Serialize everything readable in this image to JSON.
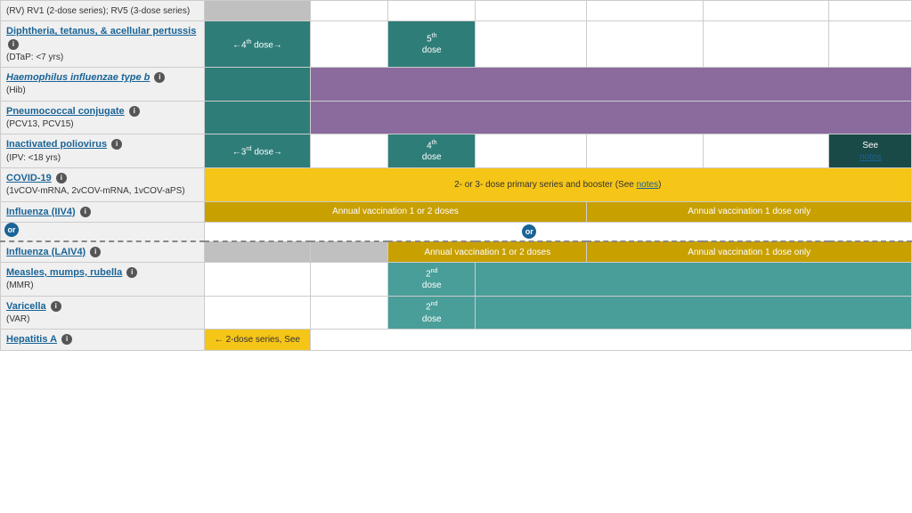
{
  "rows": [
    {
      "id": "rv",
      "label_top": "(RV) RV1 (2-dose series); RV5 (3-dose series)",
      "label_link": null,
      "label_italic": false,
      "label_sub": null,
      "show_info": false,
      "cells": [
        {
          "colspan": 1,
          "bg": "gray-cell",
          "text": ""
        },
        {
          "colspan": 1,
          "bg": "white-cell",
          "text": ""
        },
        {
          "colspan": 1,
          "bg": "white-cell",
          "text": ""
        },
        {
          "colspan": 1,
          "bg": "white-cell",
          "text": ""
        },
        {
          "colspan": 1,
          "bg": "white-cell",
          "text": ""
        },
        {
          "colspan": 1,
          "bg": "white-cell",
          "text": ""
        },
        {
          "colspan": 1,
          "bg": "white-cell",
          "text": ""
        }
      ]
    },
    {
      "id": "dtap",
      "label_top": "Diphtheria, tetanus, & acellular pertussis",
      "label_link": true,
      "label_italic": false,
      "label_sub": "(DTaP: <7 yrs)",
      "show_info": true,
      "cells": [
        {
          "colspan": 1,
          "bg": "teal-dark",
          "text": "←4th dose→"
        },
        {
          "colspan": 1,
          "bg": "white-cell",
          "text": ""
        },
        {
          "colspan": 1,
          "bg": "teal-dark",
          "text": "5th\ndose"
        },
        {
          "colspan": 1,
          "bg": "white-cell",
          "text": ""
        },
        {
          "colspan": 1,
          "bg": "white-cell",
          "text": ""
        },
        {
          "colspan": 1,
          "bg": "white-cell",
          "text": ""
        },
        {
          "colspan": 1,
          "bg": "white-cell",
          "text": ""
        }
      ]
    },
    {
      "id": "hib",
      "label_top": "Haemophilus influenzae type b",
      "label_link": true,
      "label_italic": true,
      "label_sub": "(Hib)",
      "show_info": true,
      "cells": [
        {
          "colspan": 1,
          "bg": "teal-dark",
          "text": ""
        },
        {
          "colspan": 6,
          "bg": "purple",
          "text": ""
        }
      ]
    },
    {
      "id": "pcv",
      "label_top": "Pneumococcal conjugate",
      "label_link": true,
      "label_italic": false,
      "label_sub": "(PCV13, PCV15)",
      "show_info": true,
      "cells": [
        {
          "colspan": 1,
          "bg": "teal-dark",
          "text": ""
        },
        {
          "colspan": 6,
          "bg": "purple",
          "text": ""
        }
      ]
    },
    {
      "id": "ipv",
      "label_top": "Inactivated poliovirus",
      "label_link": true,
      "label_italic": false,
      "label_sub": "(IPV: <18 yrs)",
      "show_info": true,
      "cells": [
        {
          "colspan": 1,
          "bg": "teal-dark",
          "text": "←3rd dose→"
        },
        {
          "colspan": 1,
          "bg": "white-cell",
          "text": ""
        },
        {
          "colspan": 1,
          "bg": "teal-dark",
          "text": "4th\ndose"
        },
        {
          "colspan": 1,
          "bg": "white-cell",
          "text": ""
        },
        {
          "colspan": 1,
          "bg": "white-cell",
          "text": ""
        },
        {
          "colspan": 1,
          "bg": "white-cell",
          "text": ""
        },
        {
          "colspan": 1,
          "bg": "teal-darkest",
          "text": "See\nnotes"
        }
      ]
    },
    {
      "id": "covid",
      "label_top": "COVID-19",
      "label_link": true,
      "label_italic": false,
      "label_sub": "(1vCOV-mRNA, 2vCOV-mRNA, 1vCOV-aPS)",
      "show_info": true,
      "cells": [
        {
          "colspan": 7,
          "bg": "yellow",
          "text": "2- or 3- dose primary series and booster (See notes)"
        }
      ]
    },
    {
      "id": "influenza-iiv4",
      "label_top": "Influenza (IIV4)",
      "label_link": true,
      "label_italic": false,
      "label_sub": null,
      "show_info": true,
      "cells": [
        {
          "colspan": 4,
          "bg": "yellow-dark",
          "text": "Annual vaccination 1 or 2 doses"
        },
        {
          "colspan": 3,
          "bg": "yellow-dark",
          "text": "Annual vaccination 1 dose only"
        }
      ]
    },
    {
      "id": "influenza-laiv4",
      "label_top": "Influenza (LAIV4)",
      "label_link": true,
      "label_italic": false,
      "label_sub": null,
      "show_info": true,
      "is_dashed": true,
      "cells": [
        {
          "colspan": 1,
          "bg": "gray-cell",
          "text": ""
        },
        {
          "colspan": 1,
          "bg": "gray-cell",
          "text": ""
        },
        {
          "colspan": 2,
          "bg": "yellow-dark",
          "text": "Annual vaccination 1 or 2 doses"
        },
        {
          "colspan": 3,
          "bg": "yellow-dark",
          "text": "Annual vaccination 1 dose only"
        }
      ]
    },
    {
      "id": "mmr",
      "label_top": "Measles, mumps, rubella",
      "label_link": true,
      "label_italic": false,
      "label_sub": "(MMR)",
      "show_info": true,
      "cells": [
        {
          "colspan": 1,
          "bg": "white-cell",
          "text": ""
        },
        {
          "colspan": 1,
          "bg": "white-cell",
          "text": ""
        },
        {
          "colspan": 1,
          "bg": "teal-med",
          "text": "2nd\ndose"
        },
        {
          "colspan": 4,
          "bg": "teal-med",
          "text": ""
        }
      ]
    },
    {
      "id": "varicella",
      "label_top": "Varicella",
      "label_link": true,
      "label_italic": false,
      "label_sub": "(VAR)",
      "show_info": true,
      "cells": [
        {
          "colspan": 1,
          "bg": "white-cell",
          "text": ""
        },
        {
          "colspan": 1,
          "bg": "white-cell",
          "text": ""
        },
        {
          "colspan": 1,
          "bg": "teal-med",
          "text": "2nd\ndose"
        },
        {
          "colspan": 4,
          "bg": "teal-med",
          "text": ""
        }
      ]
    },
    {
      "id": "hepa",
      "label_top": "Hepatitis A",
      "label_link": true,
      "label_italic": false,
      "label_sub": null,
      "show_info": true,
      "cells": [
        {
          "colspan": 1,
          "bg": "yellow",
          "text": "← 2-dose series, See"
        },
        {
          "colspan": 6,
          "bg": "white-cell",
          "text": ""
        }
      ]
    }
  ],
  "labels": {
    "rv_text": "(RV) RV1 (2-dose series); RV5 (3-dose series)",
    "dtap_link": "Diphtheria, tetanus, & acellular pertussis",
    "dtap_sub": "(DTaP: <7 yrs)",
    "hib_link": "Haemophilus influenzae type b",
    "hib_sub": "(Hib)",
    "pcv_link": "Pneumococcal conjugate",
    "pcv_sub": "(PCV13, PCV15)",
    "ipv_link": "Inactivated poliovirus",
    "ipv_sub": "(IPV: <18 yrs)",
    "covid_link": "COVID-19",
    "covid_sub": "(1vCOV-mRNA, 2vCOV-mRNA, 1vCOV-aPS)",
    "covid_cell": "2- or 3- dose primary series and booster (See ",
    "covid_notes": "notes",
    "covid_end": ")",
    "iiv4_link": "Influenza (IIV4)",
    "laiv4_link": "Influenza (LAIV4)",
    "mmr_link": "Measles, mumps, rubella",
    "mmr_sub": "(MMR)",
    "var_link": "Varicella",
    "var_sub": "(VAR)",
    "hepa_link": "Hepatitis A",
    "hepa_cell": "← 2-dose series, See",
    "see_notes": "See\nnotes",
    "annual_12": "Annual vaccination 1 or 2 doses",
    "annual_1": "Annual vaccination 1 dose only",
    "or_label": "or"
  }
}
